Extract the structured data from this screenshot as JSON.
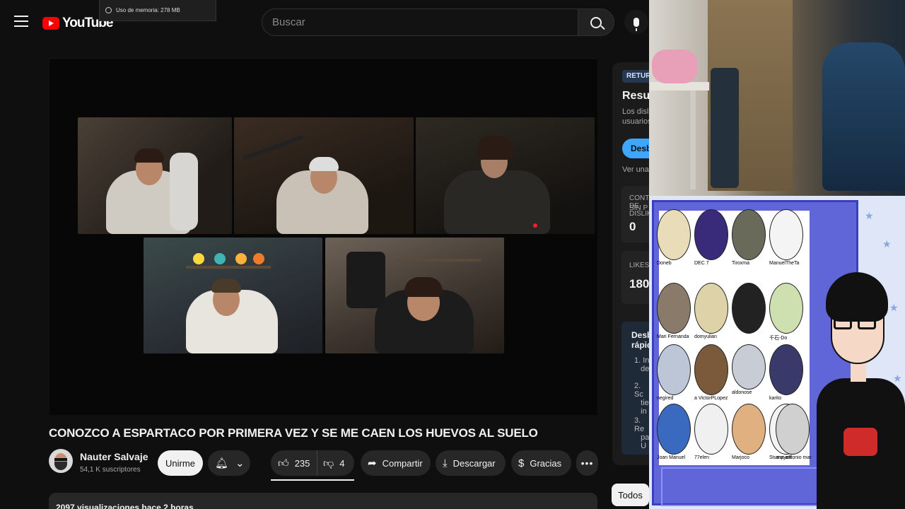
{
  "header": {
    "logo_text": "YouTube",
    "search_placeholder": "Buscar",
    "memory_tooltip": "Uso de memoria: 278 MB"
  },
  "video": {
    "title": "CONOZCO A ESPARTACO POR PRIMERA VEZ Y SE ME CAEN LOS HUEVOS AL SUELO",
    "channel": "Nauter Salvaje",
    "subscribers": "54,1 K suscriptores",
    "join_label": "Unirme",
    "likes": "235",
    "dislikes": "4",
    "share_label": "Compartir",
    "download_label": "Descargar",
    "thanks_label": "Gracias",
    "description_meta": "2097 visualizaciones  hace 2 horas"
  },
  "sidebar": {
    "badge": "RETUR",
    "title": "Resum",
    "text_lines": [
      "Los disli",
      "usuarios"
    ],
    "blue_button": "Desb",
    "link": "Ver una v",
    "stat1_label_lines": [
      "CONTEO DE DISLIKES",
      "SIN P"
    ],
    "stat1_value": "0",
    "stat2_label": "LIKES",
    "stat2_value": "180",
    "tip_title_lines": [
      "Desbl",
      "rápid"
    ],
    "tips": [
      {
        "num": "1.",
        "lines": [
          "In",
          "de"
        ]
      },
      {
        "num": "2.",
        "lines": [
          "Sc",
          "tie",
          "in"
        ]
      },
      {
        "num": "3.",
        "lines": [
          "Re",
          "pa",
          "U"
        ]
      }
    ],
    "chip": "Todos"
  },
  "supporters": [
    {
      "name": "Doneb"
    },
    {
      "name": "DEC 7"
    },
    {
      "name": "Tiroxma"
    },
    {
      "name": "ManuelTheTa"
    },
    {
      "name": "Mari Fernanda"
    },
    {
      "name": "domyulian"
    },
    {
      "name": ""
    },
    {
      "name": "千石-Do"
    },
    {
      "name": "negired"
    },
    {
      "name": "a VictorPLopez"
    },
    {
      "name": "aldonose"
    },
    {
      "name": "karito"
    },
    {
      "name": "Joan Manuel"
    },
    {
      "name": "77elen"
    },
    {
      "name": "Marjoco"
    },
    {
      "name": "Stumpyoff"
    },
    {
      "name": "ana antonio mar"
    }
  ],
  "colors": {
    "accent_red": "#ff0000",
    "link_blue": "#3ea6ff",
    "panel_purple": "#6066d8"
  },
  "icons": {
    "menu": "menu-icon",
    "search": "search-icon",
    "mic": "mic-icon",
    "bell": "bell-icon",
    "like": "thumbs-up-icon",
    "dislike": "thumbs-down-icon",
    "share": "share-icon",
    "download": "download-icon",
    "thanks": "thanks-icon",
    "more": "more-icon"
  }
}
